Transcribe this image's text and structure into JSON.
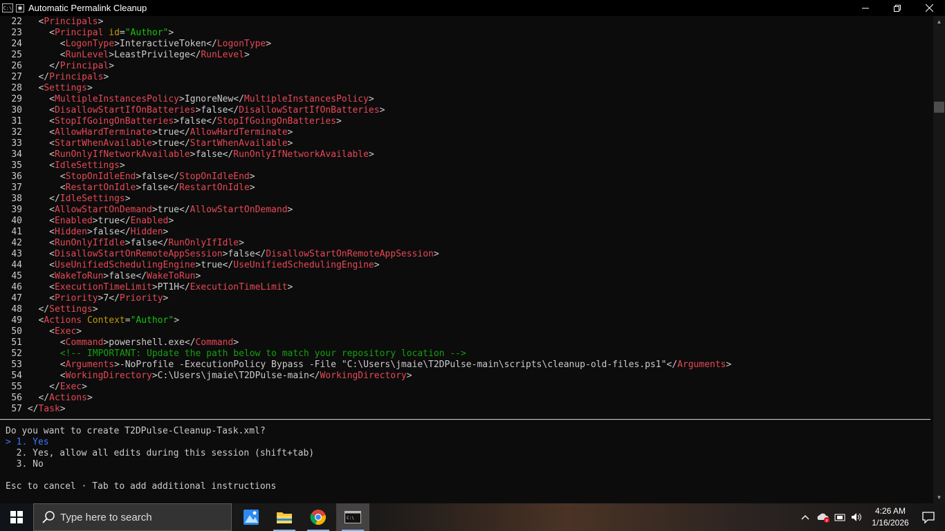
{
  "window": {
    "title": "Automatic Permalink Cleanup",
    "icon_text": "C:\\"
  },
  "code_lines": [
    {
      "n": "22",
      "indent": 2,
      "parts": [
        [
          "p",
          "<"
        ],
        [
          "t",
          "Principals"
        ],
        [
          "p",
          ">"
        ]
      ]
    },
    {
      "n": "23",
      "indent": 4,
      "parts": [
        [
          "p",
          "<"
        ],
        [
          "t",
          "Principal"
        ],
        [
          "p",
          " "
        ],
        [
          "a",
          "id"
        ],
        [
          "p",
          "="
        ],
        [
          "v",
          "\"Author\""
        ],
        [
          "p",
          ">"
        ]
      ]
    },
    {
      "n": "24",
      "indent": 6,
      "parts": [
        [
          "p",
          "<"
        ],
        [
          "t",
          "LogonType"
        ],
        [
          "p",
          ">InteractiveToken</"
        ],
        [
          "t",
          "LogonType"
        ],
        [
          "p",
          ">"
        ]
      ]
    },
    {
      "n": "25",
      "indent": 6,
      "parts": [
        [
          "p",
          "<"
        ],
        [
          "t",
          "RunLevel"
        ],
        [
          "p",
          ">LeastPrivilege</"
        ],
        [
          "t",
          "RunLevel"
        ],
        [
          "p",
          ">"
        ]
      ]
    },
    {
      "n": "26",
      "indent": 4,
      "parts": [
        [
          "p",
          "</"
        ],
        [
          "t",
          "Principal"
        ],
        [
          "p",
          ">"
        ]
      ]
    },
    {
      "n": "27",
      "indent": 2,
      "parts": [
        [
          "p",
          "</"
        ],
        [
          "t",
          "Principals"
        ],
        [
          "p",
          ">"
        ]
      ]
    },
    {
      "n": "28",
      "indent": 2,
      "parts": [
        [
          "p",
          "<"
        ],
        [
          "t",
          "Settings"
        ],
        [
          "p",
          ">"
        ]
      ]
    },
    {
      "n": "29",
      "indent": 4,
      "parts": [
        [
          "p",
          "<"
        ],
        [
          "t",
          "MultipleInstancesPolicy"
        ],
        [
          "p",
          ">IgnoreNew</"
        ],
        [
          "t",
          "MultipleInstancesPolicy"
        ],
        [
          "p",
          ">"
        ]
      ]
    },
    {
      "n": "30",
      "indent": 4,
      "parts": [
        [
          "p",
          "<"
        ],
        [
          "t",
          "DisallowStartIfOnBatteries"
        ],
        [
          "p",
          ">false</"
        ],
        [
          "t",
          "DisallowStartIfOnBatteries"
        ],
        [
          "p",
          ">"
        ]
      ]
    },
    {
      "n": "31",
      "indent": 4,
      "parts": [
        [
          "p",
          "<"
        ],
        [
          "t",
          "StopIfGoingOnBatteries"
        ],
        [
          "p",
          ">false</"
        ],
        [
          "t",
          "StopIfGoingOnBatteries"
        ],
        [
          "p",
          ">"
        ]
      ]
    },
    {
      "n": "32",
      "indent": 4,
      "parts": [
        [
          "p",
          "<"
        ],
        [
          "t",
          "AllowHardTerminate"
        ],
        [
          "p",
          ">true</"
        ],
        [
          "t",
          "AllowHardTerminate"
        ],
        [
          "p",
          ">"
        ]
      ]
    },
    {
      "n": "33",
      "indent": 4,
      "parts": [
        [
          "p",
          "<"
        ],
        [
          "t",
          "StartWhenAvailable"
        ],
        [
          "p",
          ">true</"
        ],
        [
          "t",
          "StartWhenAvailable"
        ],
        [
          "p",
          ">"
        ]
      ]
    },
    {
      "n": "34",
      "indent": 4,
      "parts": [
        [
          "p",
          "<"
        ],
        [
          "t",
          "RunOnlyIfNetworkAvailable"
        ],
        [
          "p",
          ">false</"
        ],
        [
          "t",
          "RunOnlyIfNetworkAvailable"
        ],
        [
          "p",
          ">"
        ]
      ]
    },
    {
      "n": "35",
      "indent": 4,
      "parts": [
        [
          "p",
          "<"
        ],
        [
          "t",
          "IdleSettings"
        ],
        [
          "p",
          ">"
        ]
      ]
    },
    {
      "n": "36",
      "indent": 6,
      "parts": [
        [
          "p",
          "<"
        ],
        [
          "t",
          "StopOnIdleEnd"
        ],
        [
          "p",
          ">false</"
        ],
        [
          "t",
          "StopOnIdleEnd"
        ],
        [
          "p",
          ">"
        ]
      ]
    },
    {
      "n": "37",
      "indent": 6,
      "parts": [
        [
          "p",
          "<"
        ],
        [
          "t",
          "RestartOnIdle"
        ],
        [
          "p",
          ">false</"
        ],
        [
          "t",
          "RestartOnIdle"
        ],
        [
          "p",
          ">"
        ]
      ]
    },
    {
      "n": "38",
      "indent": 4,
      "parts": [
        [
          "p",
          "</"
        ],
        [
          "t",
          "IdleSettings"
        ],
        [
          "p",
          ">"
        ]
      ]
    },
    {
      "n": "39",
      "indent": 4,
      "parts": [
        [
          "p",
          "<"
        ],
        [
          "t",
          "AllowStartOnDemand"
        ],
        [
          "p",
          ">true</"
        ],
        [
          "t",
          "AllowStartOnDemand"
        ],
        [
          "p",
          ">"
        ]
      ]
    },
    {
      "n": "40",
      "indent": 4,
      "parts": [
        [
          "p",
          "<"
        ],
        [
          "t",
          "Enabled"
        ],
        [
          "p",
          ">true</"
        ],
        [
          "t",
          "Enabled"
        ],
        [
          "p",
          ">"
        ]
      ]
    },
    {
      "n": "41",
      "indent": 4,
      "parts": [
        [
          "p",
          "<"
        ],
        [
          "t",
          "Hidden"
        ],
        [
          "p",
          ">false</"
        ],
        [
          "t",
          "Hidden"
        ],
        [
          "p",
          ">"
        ]
      ]
    },
    {
      "n": "42",
      "indent": 4,
      "parts": [
        [
          "p",
          "<"
        ],
        [
          "t",
          "RunOnlyIfIdle"
        ],
        [
          "p",
          ">false</"
        ],
        [
          "t",
          "RunOnlyIfIdle"
        ],
        [
          "p",
          ">"
        ]
      ]
    },
    {
      "n": "43",
      "indent": 4,
      "parts": [
        [
          "p",
          "<"
        ],
        [
          "t",
          "DisallowStartOnRemoteAppSession"
        ],
        [
          "p",
          ">false</"
        ],
        [
          "t",
          "DisallowStartOnRemoteAppSession"
        ],
        [
          "p",
          ">"
        ]
      ]
    },
    {
      "n": "44",
      "indent": 4,
      "parts": [
        [
          "p",
          "<"
        ],
        [
          "t",
          "UseUnifiedSchedulingEngine"
        ],
        [
          "p",
          ">true</"
        ],
        [
          "t",
          "UseUnifiedSchedulingEngine"
        ],
        [
          "p",
          ">"
        ]
      ]
    },
    {
      "n": "45",
      "indent": 4,
      "parts": [
        [
          "p",
          "<"
        ],
        [
          "t",
          "WakeToRun"
        ],
        [
          "p",
          ">false</"
        ],
        [
          "t",
          "WakeToRun"
        ],
        [
          "p",
          ">"
        ]
      ]
    },
    {
      "n": "46",
      "indent": 4,
      "parts": [
        [
          "p",
          "<"
        ],
        [
          "t",
          "ExecutionTimeLimit"
        ],
        [
          "p",
          ">PT1H</"
        ],
        [
          "t",
          "ExecutionTimeLimit"
        ],
        [
          "p",
          ">"
        ]
      ]
    },
    {
      "n": "47",
      "indent": 4,
      "parts": [
        [
          "p",
          "<"
        ],
        [
          "t",
          "Priority"
        ],
        [
          "p",
          ">7</"
        ],
        [
          "t",
          "Priority"
        ],
        [
          "p",
          ">"
        ]
      ]
    },
    {
      "n": "48",
      "indent": 2,
      "parts": [
        [
          "p",
          "</"
        ],
        [
          "t",
          "Settings"
        ],
        [
          "p",
          ">"
        ]
      ]
    },
    {
      "n": "49",
      "indent": 2,
      "parts": [
        [
          "p",
          "<"
        ],
        [
          "t",
          "Actions"
        ],
        [
          "p",
          " "
        ],
        [
          "a",
          "Context"
        ],
        [
          "p",
          "="
        ],
        [
          "v",
          "\"Author\""
        ],
        [
          "p",
          ">"
        ]
      ]
    },
    {
      "n": "50",
      "indent": 4,
      "parts": [
        [
          "p",
          "<"
        ],
        [
          "t",
          "Exec"
        ],
        [
          "p",
          ">"
        ]
      ]
    },
    {
      "n": "51",
      "indent": 6,
      "parts": [
        [
          "p",
          "<"
        ],
        [
          "t",
          "Command"
        ],
        [
          "p",
          ">powershell.exe</"
        ],
        [
          "t",
          "Command"
        ],
        [
          "p",
          ">"
        ]
      ]
    },
    {
      "n": "52",
      "indent": 6,
      "parts": [
        [
          "c",
          "<!-- IMPORTANT: Update the path below to match your repository location -->"
        ]
      ]
    },
    {
      "n": "53",
      "indent": 6,
      "parts": [
        [
          "p",
          "<"
        ],
        [
          "t",
          "Arguments"
        ],
        [
          "p",
          ">-NoProfile -ExecutionPolicy Bypass -File \"C:\\Users\\jmaie\\T2DPulse-main\\scripts\\cleanup-old-files.ps1\"</"
        ],
        [
          "t",
          "Arguments"
        ],
        [
          "p",
          ">"
        ]
      ]
    },
    {
      "n": "54",
      "indent": 6,
      "parts": [
        [
          "p",
          "<"
        ],
        [
          "t",
          "WorkingDirectory"
        ],
        [
          "p",
          ">C:\\Users\\jmaie\\T2DPulse-main</"
        ],
        [
          "t",
          "WorkingDirectory"
        ],
        [
          "p",
          ">"
        ]
      ]
    },
    {
      "n": "55",
      "indent": 4,
      "parts": [
        [
          "p",
          "</"
        ],
        [
          "t",
          "Exec"
        ],
        [
          "p",
          ">"
        ]
      ]
    },
    {
      "n": "56",
      "indent": 2,
      "parts": [
        [
          "p",
          "</"
        ],
        [
          "t",
          "Actions"
        ],
        [
          "p",
          ">"
        ]
      ]
    },
    {
      "n": "57",
      "indent": 0,
      "parts": [
        [
          "p",
          "</"
        ],
        [
          "t",
          "Task"
        ],
        [
          "p",
          ">"
        ]
      ]
    }
  ],
  "prompt": {
    "question": "Do you want to create T2DPulse-Cleanup-Task.xml?",
    "cursor": ">",
    "options": [
      {
        "num": "1.",
        "label": "Yes",
        "selected": true
      },
      {
        "num": "2.",
        "label": "Yes, allow all edits during this session (shift+tab)",
        "selected": false
      },
      {
        "num": "3.",
        "label": "No",
        "selected": false
      }
    ],
    "hint": "Esc to cancel · Tab to add additional instructions"
  },
  "taskbar": {
    "search_placeholder": "Type here to search",
    "time": "4:26 AM",
    "date": "1/16/2026",
    "apps": [
      "photos-app-icon",
      "file-explorer-icon",
      "chrome-icon",
      "terminal-icon"
    ]
  },
  "colors": {
    "tag": "#e74856",
    "attr": "#c19c00",
    "value": "#16c60c",
    "comment": "#13a10e",
    "selected": "#3b78ff",
    "text": "#cccccc"
  }
}
